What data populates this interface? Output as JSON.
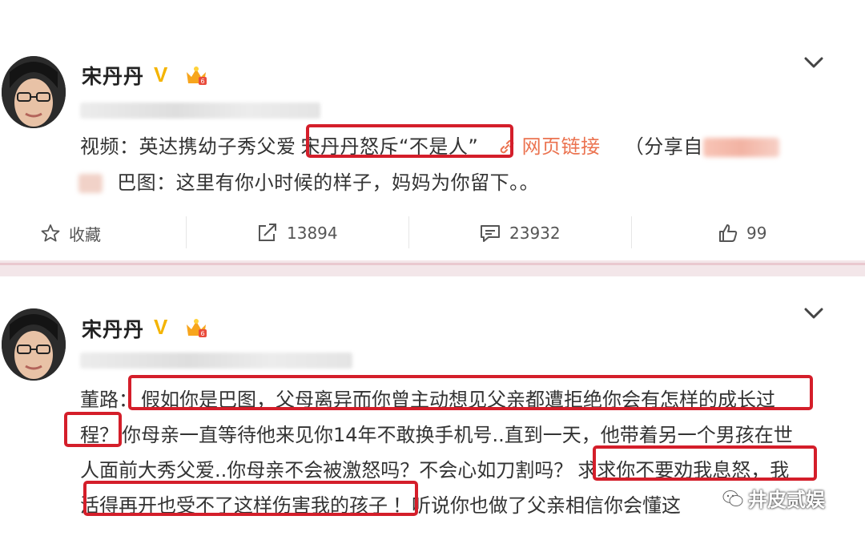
{
  "post1": {
    "username": "宋丹丹",
    "line1": {
      "prefix": "视频：英达携幼子秀父爱",
      "highlight": "宋丹丹怒斥“不是人”",
      "link_label": "网页链接",
      "share": "（分享自"
    },
    "line2": "巴图：这里有你小时候的样子，妈妈为你留下。。",
    "actions": {
      "favorite": "收藏",
      "repost": "13894",
      "comment": "23932",
      "like": "99"
    }
  },
  "post2": {
    "username": "宋丹丹",
    "lines": [
      {
        "pre": "董路：",
        "hl": "假如你是巴图，父母离异而你曾主动想见父亲都遭拒绝你会有怎样的成长过"
      },
      {
        "hl": "程？",
        "post": "你母亲一直等待他来见你14年不敢换手机号..直到一天，他带着另一个男孩在世"
      },
      {
        "pre": "人面前大秀父爱..你母亲不会被激怒吗？不会心如刀割吗？",
        "hl": "求求你不要劝我息怒，我"
      },
      {
        "hl": "活得再开也受不了这样伤害我的孩子",
        "post": "！听说你也做了父亲相信你会懂这"
      }
    ]
  },
  "watermark": "井皮贰娱",
  "colors": {
    "highlight_border": "#d41e2a",
    "link": "#eb7350",
    "verified": "#f4b400",
    "divider": "#f3e6e9"
  }
}
